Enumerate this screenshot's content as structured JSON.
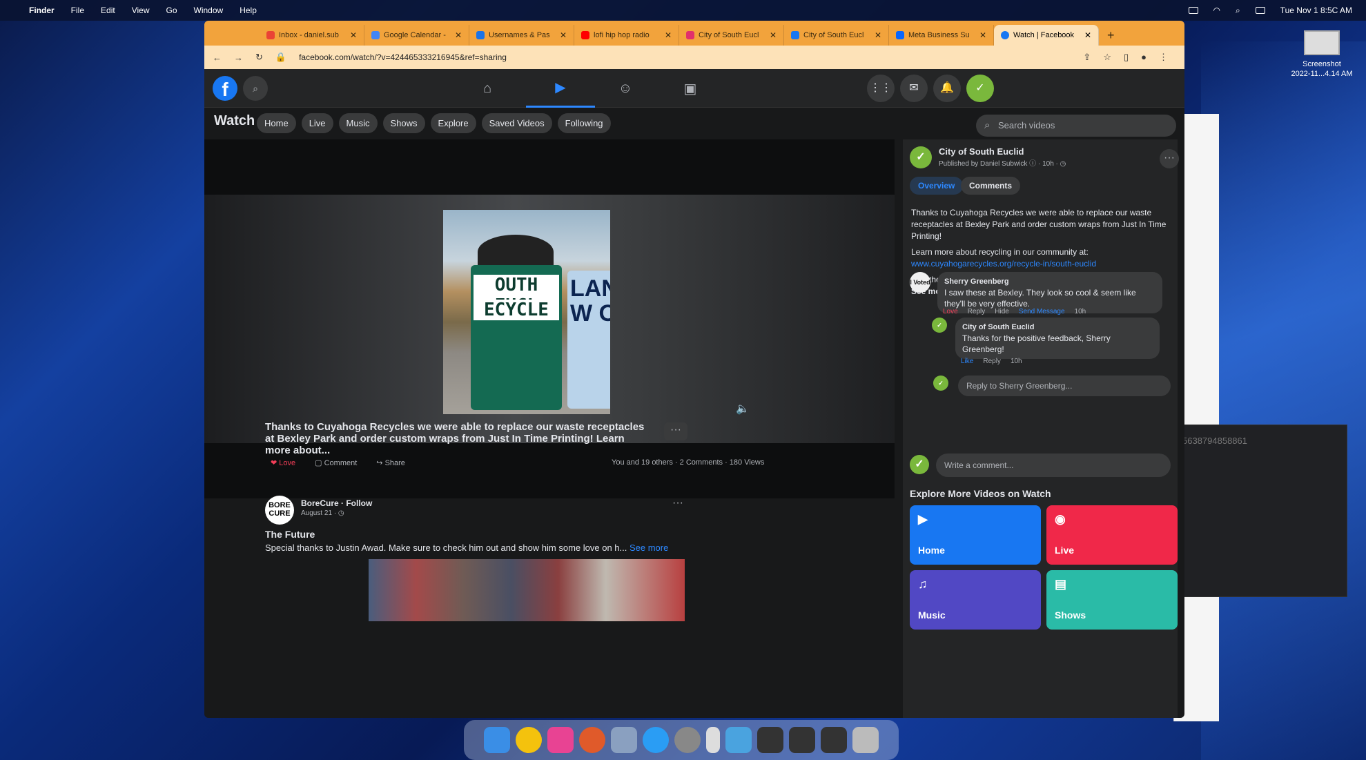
{
  "menubar": {
    "app": "Finder",
    "items": [
      "File",
      "Edit",
      "View",
      "Go",
      "Window",
      "Help"
    ],
    "clock": "Tue Nov 1  8:5C AM"
  },
  "desktop": {
    "file_label_1": "Screenshot",
    "file_label_2": "2022-11...4.14 AM"
  },
  "tabs": [
    {
      "label": "Inbox - daniel.sub",
      "color": "#ea4335"
    },
    {
      "label": "Google Calendar -",
      "color": "#4285f4"
    },
    {
      "label": "Usernames & Pas",
      "color": "#1a73e8"
    },
    {
      "label": "lofi hip hop radio",
      "color": "#ff0000"
    },
    {
      "label": "City of South Eucl",
      "color": "#e1306c"
    },
    {
      "label": "City of South Eucl",
      "color": "#1877f2"
    },
    {
      "label": "Meta Business Su",
      "color": "#0866ff"
    },
    {
      "label": "Watch | Facebook",
      "color": "#1877f2"
    }
  ],
  "url": "facebook.com/watch/?v=424465333216945&ref=sharing",
  "watch": {
    "title": "Watch",
    "chips": [
      "Home",
      "Live",
      "Music",
      "Shows",
      "Explore",
      "Saved Videos",
      "Following"
    ],
    "search_placeholder": "Search videos"
  },
  "video": {
    "bin_text_1": "OUTH EUCL",
    "bin_text_2": "ECYCLE",
    "bin2_text": "LAN W O"
  },
  "post": {
    "caption": "Thanks to Cuyahoga Recycles we were able to replace our waste receptacles at Bexley Park and order custom wraps from Just In Time Printing! Learn more about...",
    "more": "···",
    "love": "Love",
    "comment": "Comment",
    "share": "Share",
    "stats": "You and 19 others · 2 Comments · 180 Views"
  },
  "post2": {
    "avatar": "BORE CURE",
    "name": "BoreCure · Follow",
    "date": "August 21 · ◷",
    "title": "The Future",
    "text": "Special thanks to Justin Awad. Make sure to check him out and show him some love on h...",
    "see_more": " See more",
    "more": "···"
  },
  "side": {
    "page_name": "City of South Euclid",
    "meta": "Published by Daniel Subwick ⓘ · 10h · ◷",
    "dots": "···",
    "tab_overview": "Overview",
    "tab_comments": "Comments",
    "desc": "Thanks to Cuyahoga Recycles we were able to replace our waste receptacles at Bexley Park and order custom wraps from Just In Time Printing!",
    "learn": "Learn more about recycling in our community at:",
    "link": "www.cuyahogarecycles.org/recycle-in/south-euclid",
    "hashtag": "#southeucl...",
    "see_more": "See more",
    "c1_av": "I Voted",
    "c1_name": "Sherry Greenberg",
    "c1_text": "I saw these at Bexley. They look so cool & seem like they'll be very effective.",
    "c1_acts": {
      "love": "Love",
      "reply": "Reply",
      "hide": "Hide",
      "send": "Send Message",
      "time": "10h"
    },
    "c2_name": "City of South Euclid",
    "c2_text": "Thanks for the positive feedback, Sherry Greenberg!",
    "c2_acts": {
      "like": "Like",
      "reply": "Reply",
      "time": "10h"
    },
    "reply_placeholder": "Reply to Sherry Greenberg...",
    "write_placeholder": "Write a comment...",
    "explore": "Explore More Videos on Watch",
    "cards": [
      "Home",
      "Live",
      "Music",
      "Shows"
    ]
  },
  "behind": {
    "text": "5638794858861"
  }
}
